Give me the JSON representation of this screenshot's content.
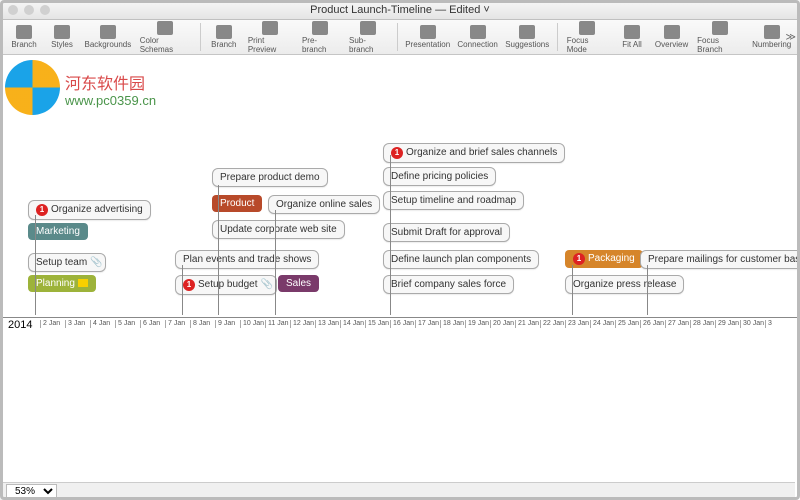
{
  "window": {
    "title": "Product Launch-Timeline — Edited ˅"
  },
  "toolbar": {
    "branch": "Branch",
    "styles": "Styles",
    "backgrounds": "Backgrounds",
    "colorSchemas": "Color Schemas",
    "branch2": "Branch",
    "printPreview": "Print Preview",
    "preBranch": "Pre-branch",
    "subBranch": "Sub-branch",
    "presentation": "Presentation",
    "connection": "Connection",
    "suggestions": "Suggestions",
    "focusMode": "Focus Mode",
    "fitAll": "Fit All",
    "overview": "Overview",
    "focusBranch": "Focus Branch",
    "numbering": "Numbering"
  },
  "watermark": {
    "brand": "河东软件园",
    "url": "www.pc0359.cn"
  },
  "nodes": {
    "planning": "Planning",
    "marketing": "Marketing",
    "product": "Product",
    "sales": "Sales",
    "packaging": "Packaging",
    "organizeAdvertising": "Organize advertising",
    "setupTeam": "Setup team",
    "setupBudget": "Setup budget",
    "prepareProductDemo": "Prepare product demo",
    "updateWebsite": "Update corporate web site",
    "planEvents": "Plan events and trade shows",
    "organizeOnlineSales": "Organize online sales",
    "organizeSalesChannels": "Organize and brief sales channels",
    "definePricing": "Define pricing policies",
    "setupTimeline": "Setup timeline and roadmap",
    "submitDraft": "Submit Draft for approval",
    "defineLaunchPlan": "Define launch plan components",
    "briefSalesForce": "Brief company sales force",
    "organizePress": "Organize press release",
    "prepareMailings": "Prepare mailings for customer bas"
  },
  "timeline": {
    "year": "2014",
    "ticks": [
      "2 Jan",
      "3 Jan",
      "4 Jan",
      "5 Jan",
      "6 Jan",
      "7 Jan",
      "8 Jan",
      "9 Jan",
      "10 Jan",
      "11 Jan",
      "12 Jan",
      "13 Jan",
      "14 Jan",
      "15 Jan",
      "16 Jan",
      "17 Jan",
      "18 Jan",
      "19 Jan",
      "20 Jan",
      "21 Jan",
      "22 Jan",
      "23 Jan",
      "24 Jan",
      "25 Jan",
      "26 Jan",
      "27 Jan",
      "28 Jan",
      "29 Jan",
      "30 Jan",
      "3"
    ]
  },
  "status": {
    "zoom": "53%"
  },
  "priority": "1"
}
